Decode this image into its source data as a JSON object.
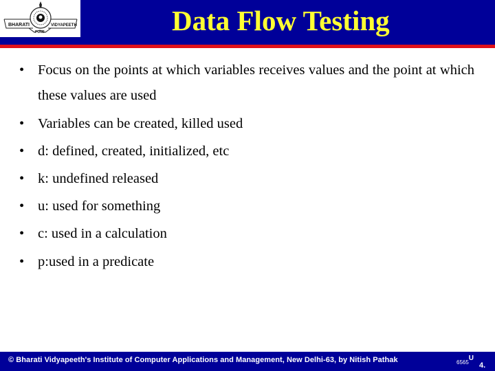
{
  "header": {
    "title": "Data Flow Testing",
    "logo": {
      "left_text": "BHARATI",
      "right_text": "VIDYAPEETH",
      "bottom_text": "PUNE",
      "icon": "institute-emblem-icon"
    }
  },
  "bullets": [
    "Focus on the points at which variables receives values and the point at which these values are used",
    "Variables can be  created, killed used",
    "d: defined, created, initialized, etc",
    "k: undefined released",
    "u: used for something",
    "c: used in a calculation",
    "p:used in a predicate"
  ],
  "bullet_glyph": "•",
  "footer": {
    "copyright": "© Bharati Vidyapeeth's Institute of Computer Applications and Management, New Delhi-63, by  Nitish Pathak",
    "page_code": "6565",
    "page_sup": "U",
    "page_line2": "4."
  },
  "colors": {
    "header_bg": "#000099",
    "title": "#ffff33",
    "rule": "#e0101a",
    "footer_bg": "#000099"
  }
}
